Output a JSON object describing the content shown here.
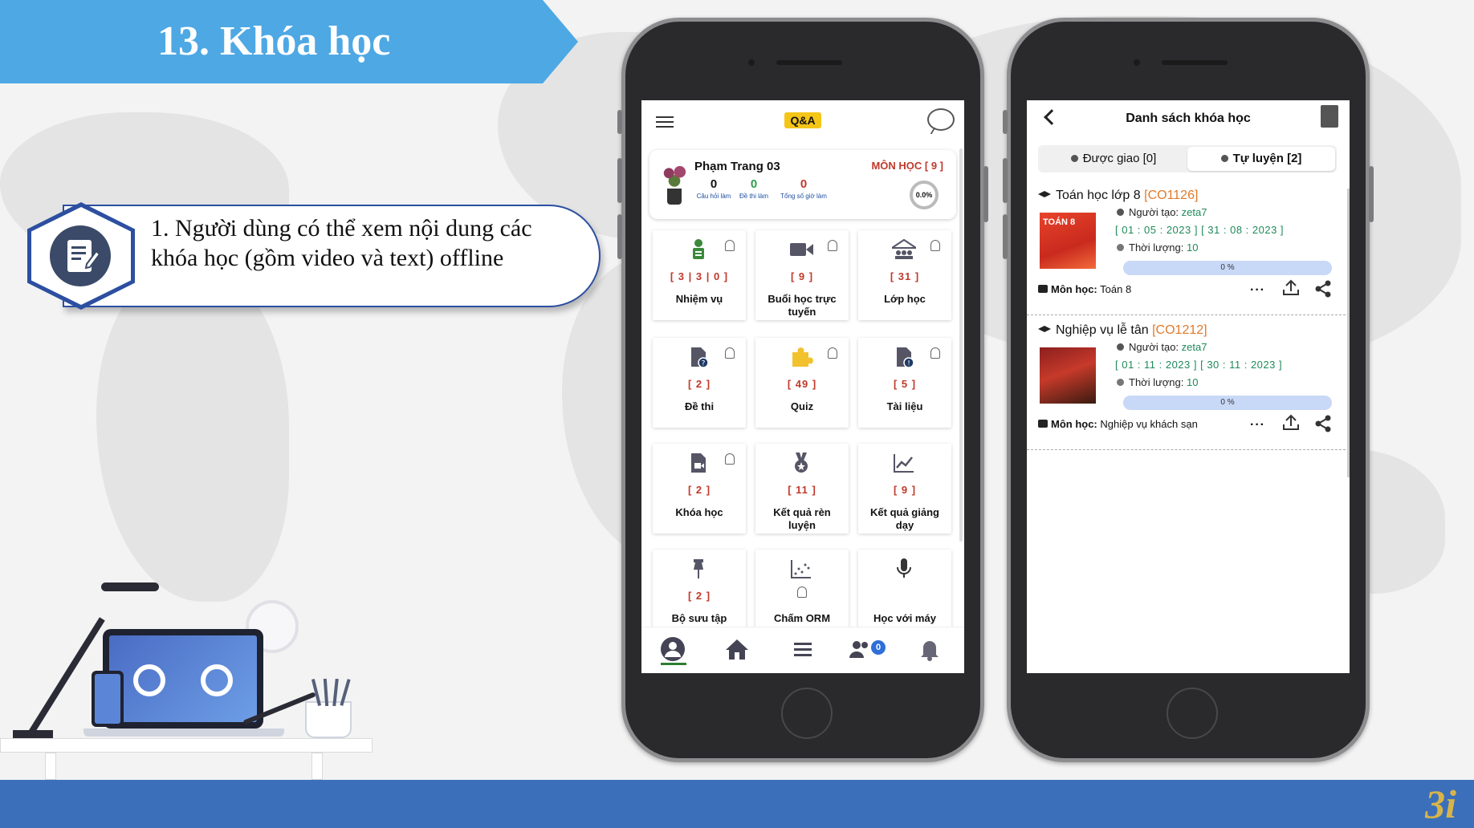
{
  "slide": {
    "title": "13. Khóa học",
    "description": "1. Người dùng có thể xem nội dung các khóa học (gồm video và text) offline",
    "logo": "3i"
  },
  "phone1": {
    "header": {
      "badge": "Q&A"
    },
    "profile": {
      "name": "Phạm Trang 03",
      "subjects": "MÔN HỌC [ 9 ]",
      "stats": [
        {
          "value": "0",
          "label": "Câu hỏi làm",
          "color": "#111111"
        },
        {
          "value": "0",
          "label": "Đề thi làm",
          "color": "#2e9e4a"
        },
        {
          "value": "0",
          "label": "Tổng số giờ làm",
          "color": "#c0392b"
        }
      ],
      "progress": "0.0%"
    },
    "tiles": [
      {
        "count": "[ 3 | 3 | 0 ]",
        "label": "Nhiệm vụ",
        "icon": "task-icon"
      },
      {
        "count": "[ 9 ]",
        "label": "Buổi học trực tuyến",
        "icon": "video-camera-icon"
      },
      {
        "count": "[ 31 ]",
        "label": "Lớp học",
        "icon": "classroom-icon"
      },
      {
        "count": "[ 2 ]",
        "label": "Đề thi",
        "icon": "exam-doc-icon"
      },
      {
        "count": "[ 49 ]",
        "label": "Quiz",
        "icon": "puzzle-icon"
      },
      {
        "count": "[ 5 ]",
        "label": "Tài liệu",
        "icon": "document-icon"
      },
      {
        "count": "[ 2 ]",
        "label": "Khóa học",
        "icon": "course-video-icon"
      },
      {
        "count": "[ 11 ]",
        "label": "Kết quả rèn luyện",
        "icon": "medal-icon"
      },
      {
        "count": "[ 9 ]",
        "label": "Kết quả giảng dạy",
        "icon": "line-chart-icon"
      },
      {
        "count": "[ 2 ]",
        "label": "Bộ sưu tập",
        "icon": "pin-icon"
      },
      {
        "count": "",
        "label": "Chấm ORM",
        "icon": "scatter-chart-icon"
      },
      {
        "count": "",
        "label": "Học với máy",
        "icon": "microphone-icon"
      }
    ],
    "nav": {
      "friends_badge": "0"
    }
  },
  "phone2": {
    "title": "Danh sách khóa học",
    "tabs": {
      "assigned": "Được giao [0]",
      "self": "Tự luyện [2]"
    },
    "courses": [
      {
        "name": "Toán học lớp 8",
        "code": "[CO1126]",
        "creator_label": "Người tạo:",
        "creator": "zeta7",
        "dates": "[ 01 : 05 : 2023 ] [ 31 : 08 : 2023 ]",
        "duration_label": "Thời lượng:",
        "duration": "10",
        "progress": "0 %",
        "subject_label": "Môn học:",
        "subject": "Toán 8",
        "thumb_text": "TOÁN 8"
      },
      {
        "name": "Nghiệp vụ lễ tân",
        "code": "[CO1212]",
        "creator_label": "Người tạo:",
        "creator": "zeta7",
        "dates": "[ 01 : 11 : 2023 ] [ 30 : 11 : 2023 ]",
        "duration_label": "Thời lượng:",
        "duration": "10",
        "progress": "0 %",
        "subject_label": "Môn học:",
        "subject": "Nghiệp vụ khách sạn",
        "thumb_text": ""
      }
    ],
    "more_label": "···"
  }
}
